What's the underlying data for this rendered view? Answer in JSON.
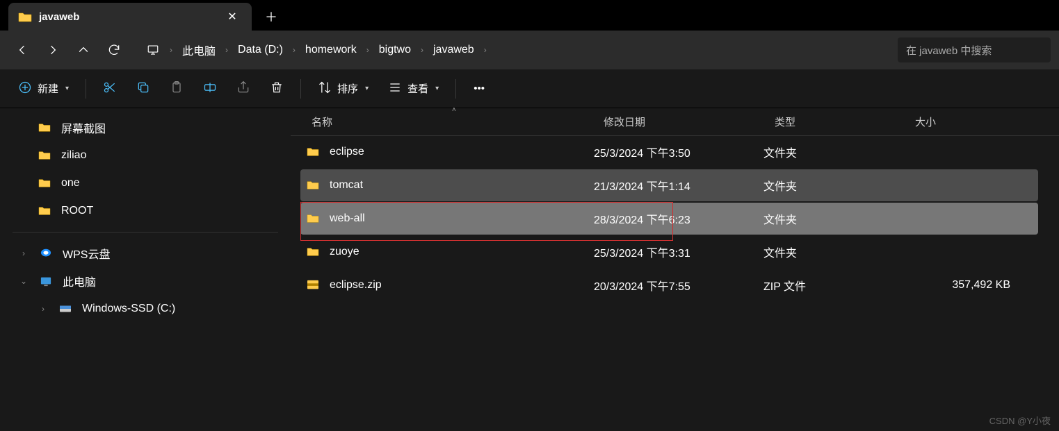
{
  "tab": {
    "title": "javaweb"
  },
  "breadcrumb": {
    "root": "此电脑",
    "parts": [
      "Data (D:)",
      "homework",
      "bigtwo",
      "javaweb"
    ]
  },
  "search": {
    "placeholder": "在 javaweb 中搜索"
  },
  "toolbar": {
    "new": "新建",
    "sort": "排序",
    "view": "查看"
  },
  "columns": {
    "name": "名称",
    "date": "修改日期",
    "type": "类型",
    "size": "大小"
  },
  "sidebar": {
    "items": [
      {
        "label": "屏幕截图",
        "icon": "folder",
        "indent": 1
      },
      {
        "label": "ziliao",
        "icon": "folder",
        "indent": 1
      },
      {
        "label": "one",
        "icon": "folder",
        "indent": 1
      },
      {
        "label": "ROOT",
        "icon": "folder",
        "indent": 1
      }
    ],
    "section2": [
      {
        "label": "WPS云盘",
        "icon": "wps",
        "chev": "right",
        "indent": 0
      },
      {
        "label": "此电脑",
        "icon": "pc",
        "chev": "down",
        "indent": 0
      },
      {
        "label": "Windows-SSD (C:)",
        "icon": "drive",
        "chev": "right",
        "indent": 1
      }
    ]
  },
  "files": [
    {
      "name": "eclipse",
      "date": "25/3/2024 下午3:50",
      "type": "文件夹",
      "size": "",
      "icon": "folder",
      "state": ""
    },
    {
      "name": "tomcat",
      "date": "21/3/2024 下午1:14",
      "type": "文件夹",
      "size": "",
      "icon": "folder",
      "state": "hover"
    },
    {
      "name": "web-all",
      "date": "28/3/2024 下午6:23",
      "type": "文件夹",
      "size": "",
      "icon": "folder",
      "state": "selected"
    },
    {
      "name": "zuoye",
      "date": "25/3/2024 下午3:31",
      "type": "文件夹",
      "size": "",
      "icon": "folder",
      "state": ""
    },
    {
      "name": "eclipse.zip",
      "date": "20/3/2024 下午7:55",
      "type": "ZIP 文件",
      "size": "357,492 KB",
      "icon": "zip",
      "state": ""
    }
  ],
  "watermark": "CSDN @Y小夜"
}
